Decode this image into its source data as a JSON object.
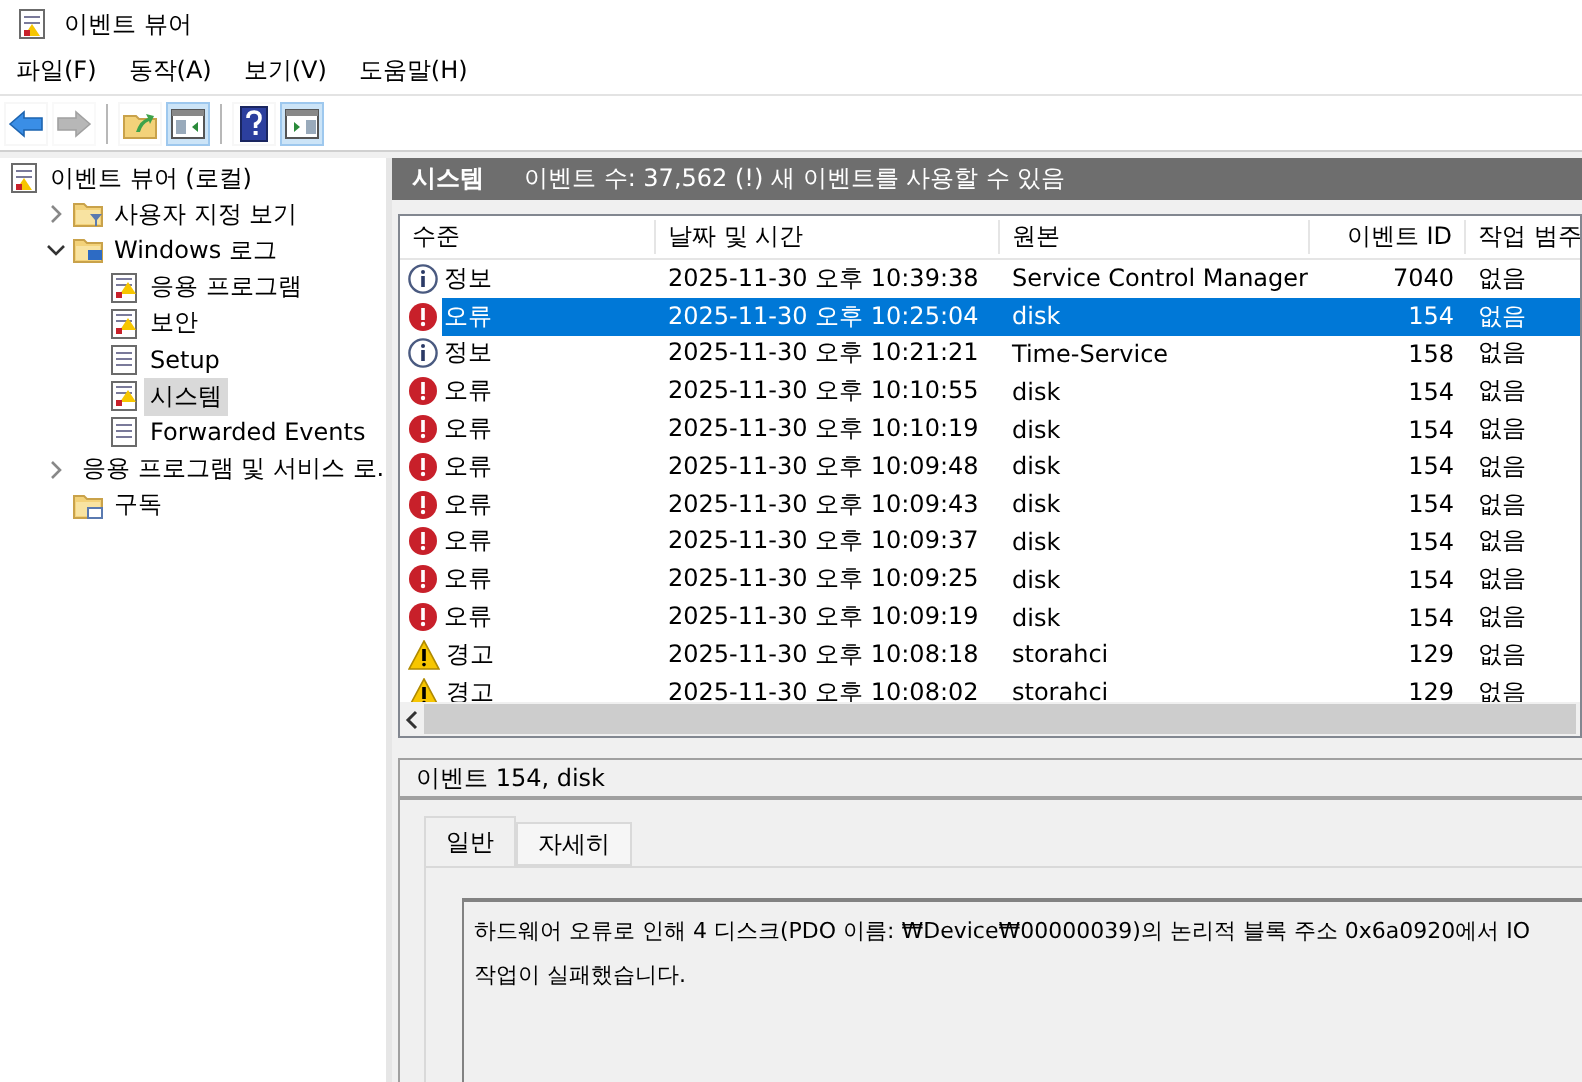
{
  "window": {
    "title": "이벤트 뷰어"
  },
  "menu": [
    "파일(F)",
    "동작(A)",
    "보기(V)",
    "도움말(H)"
  ],
  "toolbar": [
    {
      "buttons": [
        {
          "kind": "back",
          "pressed": false,
          "disabled": false
        },
        {
          "kind": "forward",
          "pressed": false,
          "disabled": true
        }
      ]
    },
    {
      "buttons": [
        {
          "kind": "folder-up",
          "pressed": false,
          "disabled": false
        },
        {
          "kind": "pane-left",
          "pressed": true,
          "disabled": false
        }
      ]
    },
    {
      "buttons": [
        {
          "kind": "help",
          "pressed": false,
          "disabled": false
        },
        {
          "kind": "pane-right",
          "pressed": true,
          "disabled": false
        }
      ]
    }
  ],
  "tree": [
    {
      "label": "이벤트 뷰어 (로컬)",
      "selected": false,
      "children": [
        {
          "label": "사용자 지정 보기",
          "selected": false,
          "expanded": false
        },
        {
          "label": "Windows 로그",
          "selected": false,
          "expanded": true,
          "children": [
            {
              "label": "응용 프로그램",
              "selected": false
            },
            {
              "label": "보안",
              "selected": false
            },
            {
              "label": "Setup",
              "selected": false
            },
            {
              "label": "시스템",
              "selected": true
            },
            {
              "label": "Forwarded Events",
              "selected": false
            }
          ]
        },
        {
          "label": "응용 프로그램 및 서비스 로.",
          "selected": false,
          "expanded": false
        },
        {
          "label": "구독",
          "selected": false
        }
      ]
    }
  ],
  "log_header": {
    "title": "시스템",
    "info": "이벤트 수: 37,562 (!) 새 이벤트를 사용할 수 있음"
  },
  "table": {
    "columns": [
      "수준",
      "날짜 및 시간",
      "원본",
      "이벤트 ID",
      "작업 범주"
    ],
    "rows": [
      {
        "kind": "info",
        "level": "정보",
        "date": "2025-11-30 오후 10:39:38",
        "source": "Service Control Manager",
        "id": "7040",
        "category": "없음",
        "selected": false
      },
      {
        "kind": "error",
        "level": "오류",
        "date": "2025-11-30 오후 10:25:04",
        "source": "disk",
        "id": "154",
        "category": "없음",
        "selected": true
      },
      {
        "kind": "info",
        "level": "정보",
        "date": "2025-11-30 오후 10:21:21",
        "source": "Time-Service",
        "id": "158",
        "category": "없음",
        "selected": false
      },
      {
        "kind": "error",
        "level": "오류",
        "date": "2025-11-30 오후 10:10:55",
        "source": "disk",
        "id": "154",
        "category": "없음",
        "selected": false
      },
      {
        "kind": "error",
        "level": "오류",
        "date": "2025-11-30 오후 10:10:19",
        "source": "disk",
        "id": "154",
        "category": "없음",
        "selected": false
      },
      {
        "kind": "error",
        "level": "오류",
        "date": "2025-11-30 오후 10:09:48",
        "source": "disk",
        "id": "154",
        "category": "없음",
        "selected": false
      },
      {
        "kind": "error",
        "level": "오류",
        "date": "2025-11-30 오후 10:09:43",
        "source": "disk",
        "id": "154",
        "category": "없음",
        "selected": false
      },
      {
        "kind": "error",
        "level": "오류",
        "date": "2025-11-30 오후 10:09:37",
        "source": "disk",
        "id": "154",
        "category": "없음",
        "selected": false
      },
      {
        "kind": "error",
        "level": "오류",
        "date": "2025-11-30 오후 10:09:25",
        "source": "disk",
        "id": "154",
        "category": "없음",
        "selected": false
      },
      {
        "kind": "error",
        "level": "오류",
        "date": "2025-11-30 오후 10:09:19",
        "source": "disk",
        "id": "154",
        "category": "없음",
        "selected": false
      },
      {
        "kind": "warning",
        "level": "경고",
        "date": "2025-11-30 오후 10:08:18",
        "source": "storahci",
        "id": "129",
        "category": "없음",
        "selected": false
      },
      {
        "kind": "warning",
        "level": "경고",
        "date": "2025-11-30 오후 10:08:02",
        "source": "storahci",
        "id": "129",
        "category": "없음",
        "selected": false
      }
    ]
  },
  "detail": {
    "title": "이벤트 154, disk",
    "tabs": [
      {
        "label": "일반",
        "selected": true
      },
      {
        "label": "자세히",
        "selected": false
      }
    ],
    "message": "하드웨어 오류로 인해 4 디스크(PDO 이름: ₩Device₩00000039)의 논리적 블록 주소 0x6a0920에서 IO 작업이 실패했습니다."
  }
}
